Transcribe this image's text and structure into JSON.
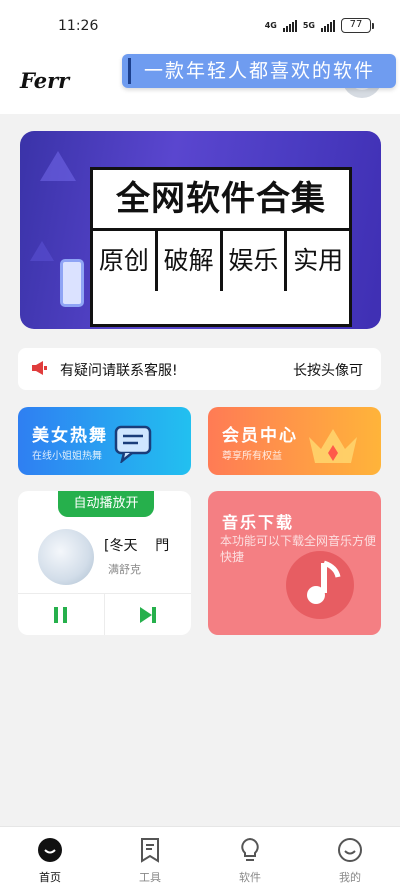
{
  "status_bar": {
    "time": "11:26",
    "network_1": "4G",
    "network_2": "5G",
    "battery": "77"
  },
  "app_bar": {
    "logo": "Ferr",
    "slogan": "一款年轻人都喜欢的软件"
  },
  "banner": {
    "title": "全网软件合集",
    "tags": [
      "原创",
      "破解",
      "娱乐",
      "实用"
    ],
    "colors": {
      "background": "#4b3cc2"
    }
  },
  "notice": {
    "icon": "megaphone-icon",
    "text": "有疑问请联系客服!",
    "right_text": "长按头像可"
  },
  "cards": {
    "beauty": {
      "title": "美女热舞",
      "subtitle": "在线小姐姐热舞",
      "icon": "chat-icon"
    },
    "vip": {
      "title": "会员中心",
      "subtitle": "尊享所有权益",
      "icon": "crown-icon"
    },
    "music": {
      "title": "音乐下载",
      "description": "本功能可以下载全网音乐方便快捷",
      "icon": "music-note-icon",
      "color": "#f47f83"
    }
  },
  "player": {
    "autoplay_label": "自动播放开",
    "song_title": "[冬天",
    "song_title_suffix": "門",
    "artist": "满舒克",
    "accent": "#26b04c"
  },
  "tabbar": {
    "tabs": [
      {
        "label": "首页",
        "icon": "home-icon",
        "active": true
      },
      {
        "label": "工具",
        "icon": "bookmark-icon",
        "active": false
      },
      {
        "label": "软件",
        "icon": "bulb-icon",
        "active": false
      },
      {
        "label": "我的",
        "icon": "smile-icon",
        "active": false
      }
    ]
  }
}
